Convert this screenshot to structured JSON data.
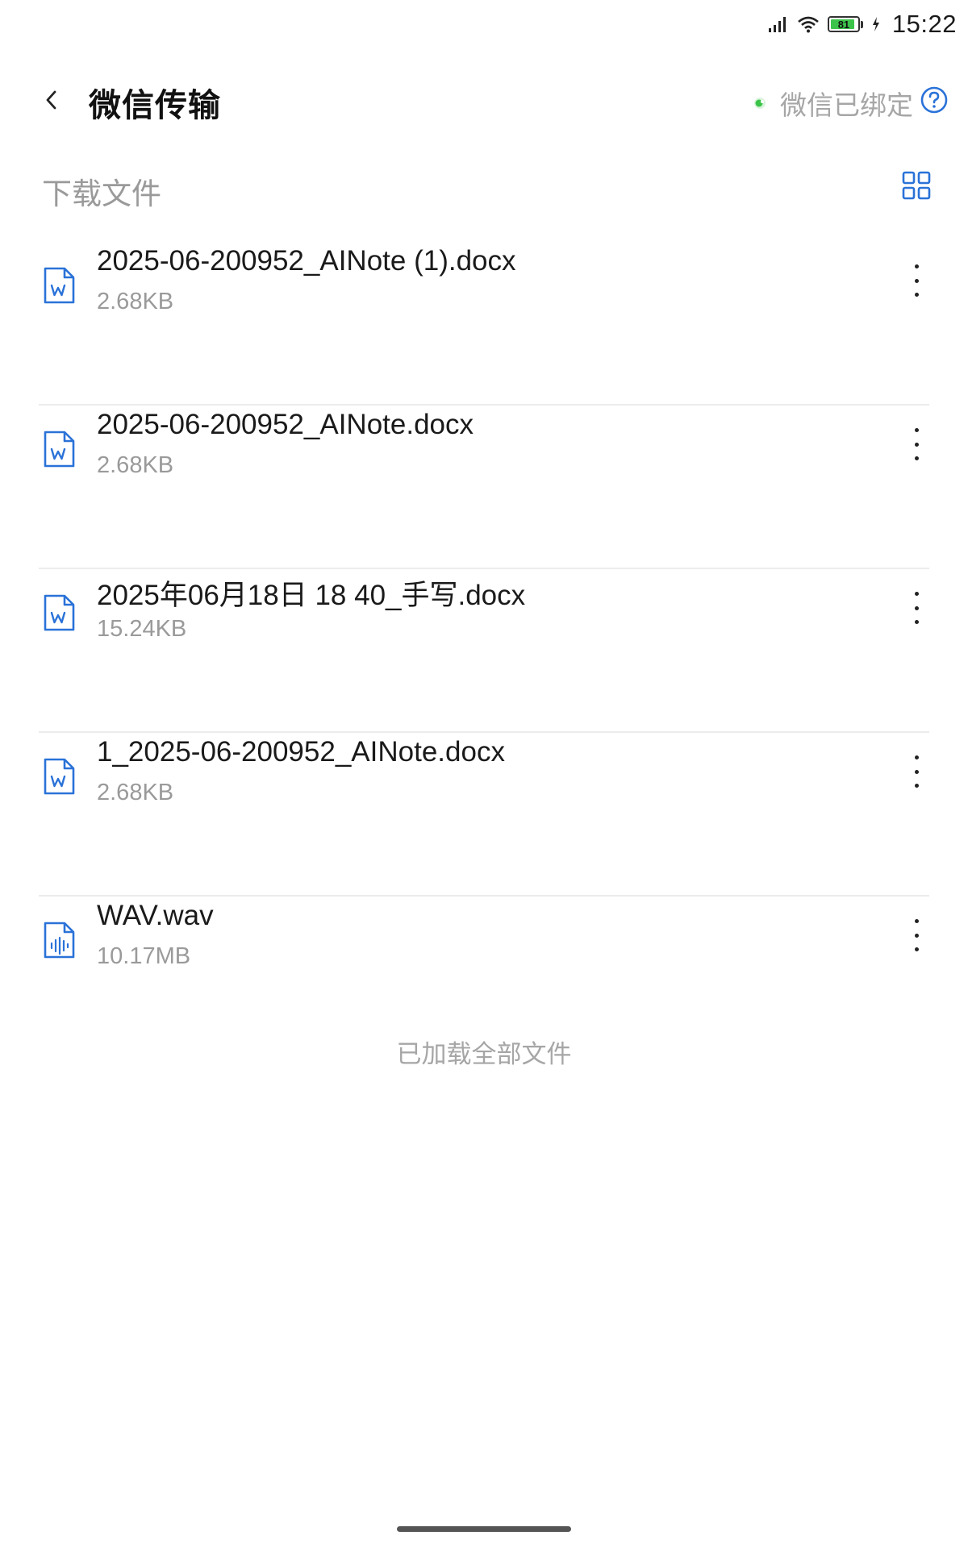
{
  "status_bar": {
    "time": "15:22",
    "battery_level": "81",
    "icons": [
      "signal-icon",
      "wifi-icon",
      "battery-icon",
      "charging-icon"
    ]
  },
  "header": {
    "title": "微信传输",
    "bind_status": "微信已绑定",
    "icons": [
      "back-arrow-icon",
      "wechat-dot-icon",
      "help-icon"
    ]
  },
  "section": {
    "title": "下载文件",
    "view_toggle_icon": "grid-view-icon"
  },
  "files": [
    {
      "name": "2025-06-200952_AINote (1).docx",
      "size": "2.68KB",
      "type": "word"
    },
    {
      "name": "2025-06-200952_AINote.docx",
      "size": "2.68KB",
      "type": "word"
    },
    {
      "name": "2025年06月18日 18 40_手写.docx",
      "size": "15.24KB",
      "type": "word"
    },
    {
      "name": "1_2025-06-200952_AINote.docx",
      "size": "2.68KB",
      "type": "word"
    },
    {
      "name": "WAV.wav",
      "size": "10.17MB",
      "type": "audio"
    }
  ],
  "footer": {
    "note": "已加载全部文件"
  },
  "colors": {
    "accent": "#2a72d8",
    "wechat_green": "#3cc44a",
    "secondary_text": "#9a9a9a",
    "divider": "#ececec"
  }
}
